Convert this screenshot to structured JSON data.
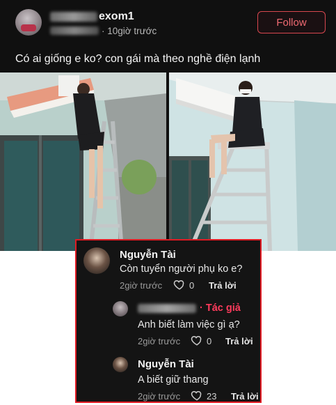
{
  "post": {
    "username": "exom1",
    "time": "· 10giờ trước",
    "follow_label": "Follow",
    "caption": "Có ai giống e ko? con gái mà theo nghề điện lạnh"
  },
  "comments": [
    {
      "author": "Nguyễn Tài",
      "text": "Còn tuyển người phụ ko e?",
      "time": "2giờ trước",
      "likes": "0",
      "reply_label": "Trả lời"
    },
    {
      "author_badge": "Tác giả",
      "text": "Anh biết làm việc gì ạ?",
      "time": "2giờ trước",
      "likes": "0",
      "reply_label": "Trả lời"
    },
    {
      "author": "Nguyễn Tài",
      "text": "A biết giữ thang",
      "time": "2giờ trước",
      "likes": "23",
      "reply_label": "Trả lời"
    }
  ],
  "colors": {
    "background": "#101010",
    "follow_accent": "#d9474f",
    "author_badge": "#ff3b5c",
    "highlight_border": "#e01a22"
  },
  "icons": [
    "heart-outline-icon"
  ]
}
